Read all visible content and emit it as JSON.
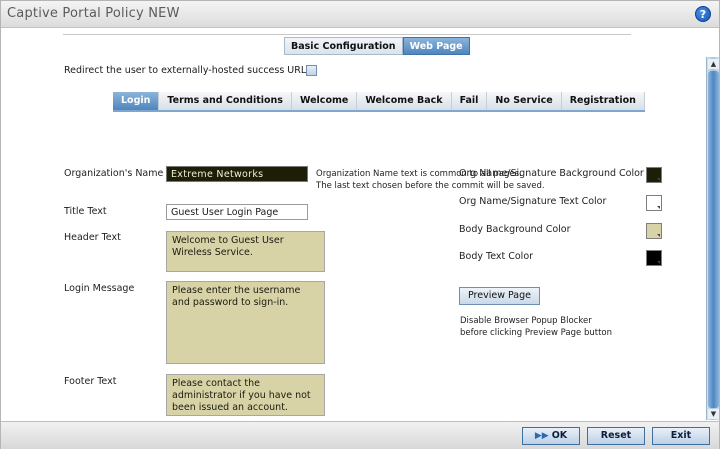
{
  "window": {
    "title": "Captive Portal Policy  NEW",
    "help_glyph": "?"
  },
  "top_tabs": [
    {
      "label": "Basic Configuration",
      "active": false
    },
    {
      "label": "Web Page",
      "active": true
    }
  ],
  "redirect": {
    "label": "Redirect the user to externally-hosted success URL",
    "checked": false
  },
  "page_tabs": [
    {
      "label": "Login",
      "active": true
    },
    {
      "label": "Terms and Conditions",
      "active": false
    },
    {
      "label": "Welcome",
      "active": false
    },
    {
      "label": "Welcome Back",
      "active": false
    },
    {
      "label": "Fail",
      "active": false
    },
    {
      "label": "No Service",
      "active": false
    },
    {
      "label": "Registration",
      "active": false
    }
  ],
  "form": {
    "org_name_label": "Organization's Name",
    "org_name_value": "Extreme  Networks",
    "org_note_line1": "Organization Name text is common to all pages.",
    "org_note_line2": "The last text chosen before the commit will be saved.",
    "title_label": "Title Text",
    "title_value": "Guest User Login Page",
    "header_label": "Header Text",
    "header_value": "Welcome to Guest User Wireless Service.",
    "login_label": "Login Message",
    "login_value": "Please enter the username and password to sign-in.",
    "footer_label": "Footer Text",
    "footer_value": "Please contact the administrator if you have not been issued an account."
  },
  "colors": {
    "org_bg_label": "Org Name/Signature Background Color",
    "org_bg_color": "#1d1d08",
    "org_text_label": "Org Name/Signature Text Color",
    "org_text_color": "#ffffff",
    "body_bg_label": "Body Background Color",
    "body_bg_color": "#d8d3a6",
    "body_text_label": "Body Text Color",
    "body_text_color": "#000000"
  },
  "preview": {
    "button_label": "Preview Page",
    "note_line1": "Disable Browser Popup Blocker",
    "note_line2": "before clicking Preview Page button"
  },
  "footer": {
    "ok_label": "OK",
    "reset_label": "Reset",
    "exit_label": "Exit"
  },
  "scrollbar": {
    "up_icon": "chevron-up-icon",
    "down_icon": "chevron-down-icon"
  }
}
